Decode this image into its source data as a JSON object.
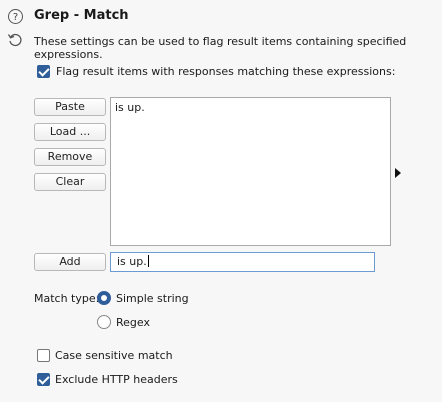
{
  "header": {
    "title": "Grep - Match",
    "description": "These settings can be used to flag result items containing specified expressions."
  },
  "flag_checkbox": {
    "label": "Flag result items with responses matching these expressions:",
    "checked": true
  },
  "buttons": {
    "paste": "Paste",
    "load": "Load ...",
    "remove": "Remove",
    "clear": "Clear",
    "add": "Add"
  },
  "expressions": [
    "is up."
  ],
  "add_input": {
    "value": "is up."
  },
  "match_type": {
    "label": "Match type:",
    "options": [
      "Simple string",
      "Regex"
    ],
    "selected": "Simple string"
  },
  "case_sensitive": {
    "label": "Case sensitive match",
    "checked": false
  },
  "exclude_headers": {
    "label": "Exclude HTTP headers",
    "checked": true
  },
  "icons": {
    "help": "help-icon",
    "reset": "reset-icon"
  },
  "colors": {
    "accent": "#2f5e9a",
    "input_focus": "#6b9bd1"
  }
}
